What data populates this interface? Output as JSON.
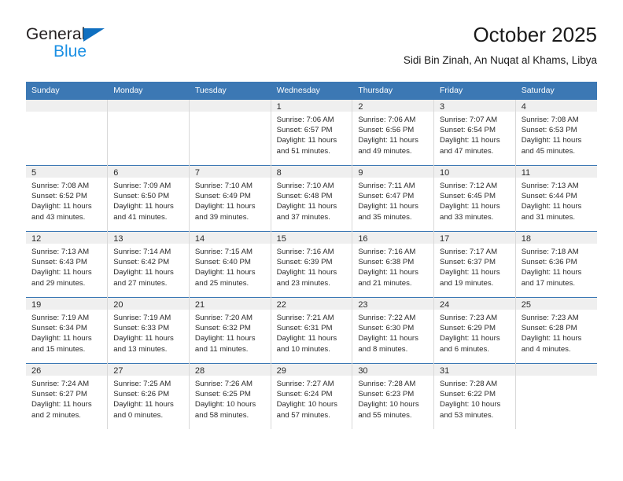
{
  "logo": {
    "word_one": "General",
    "word_two": "Blue",
    "triangle_color": "#0f6fc0",
    "blue_color": "#1a8fe3"
  },
  "header": {
    "title": "October 2025",
    "subtitle": "Sidi Bin Zinah, An Nuqat al Khams, Libya"
  },
  "theme": {
    "header_bg": "#3c78b4",
    "daynum_bg": "#efefef",
    "cell_divider": "#d9d9d9"
  },
  "weekday_headers": [
    "Sunday",
    "Monday",
    "Tuesday",
    "Wednesday",
    "Thursday",
    "Friday",
    "Saturday"
  ],
  "weeks": [
    [
      {
        "day": "",
        "sunrise": "",
        "sunset": "",
        "daylight_line1": "",
        "daylight_line2": ""
      },
      {
        "day": "",
        "sunrise": "",
        "sunset": "",
        "daylight_line1": "",
        "daylight_line2": ""
      },
      {
        "day": "",
        "sunrise": "",
        "sunset": "",
        "daylight_line1": "",
        "daylight_line2": ""
      },
      {
        "day": "1",
        "sunrise": "Sunrise: 7:06 AM",
        "sunset": "Sunset: 6:57 PM",
        "daylight_line1": "Daylight: 11 hours",
        "daylight_line2": "and 51 minutes."
      },
      {
        "day": "2",
        "sunrise": "Sunrise: 7:06 AM",
        "sunset": "Sunset: 6:56 PM",
        "daylight_line1": "Daylight: 11 hours",
        "daylight_line2": "and 49 minutes."
      },
      {
        "day": "3",
        "sunrise": "Sunrise: 7:07 AM",
        "sunset": "Sunset: 6:54 PM",
        "daylight_line1": "Daylight: 11 hours",
        "daylight_line2": "and 47 minutes."
      },
      {
        "day": "4",
        "sunrise": "Sunrise: 7:08 AM",
        "sunset": "Sunset: 6:53 PM",
        "daylight_line1": "Daylight: 11 hours",
        "daylight_line2": "and 45 minutes."
      }
    ],
    [
      {
        "day": "5",
        "sunrise": "Sunrise: 7:08 AM",
        "sunset": "Sunset: 6:52 PM",
        "daylight_line1": "Daylight: 11 hours",
        "daylight_line2": "and 43 minutes."
      },
      {
        "day": "6",
        "sunrise": "Sunrise: 7:09 AM",
        "sunset": "Sunset: 6:50 PM",
        "daylight_line1": "Daylight: 11 hours",
        "daylight_line2": "and 41 minutes."
      },
      {
        "day": "7",
        "sunrise": "Sunrise: 7:10 AM",
        "sunset": "Sunset: 6:49 PM",
        "daylight_line1": "Daylight: 11 hours",
        "daylight_line2": "and 39 minutes."
      },
      {
        "day": "8",
        "sunrise": "Sunrise: 7:10 AM",
        "sunset": "Sunset: 6:48 PM",
        "daylight_line1": "Daylight: 11 hours",
        "daylight_line2": "and 37 minutes."
      },
      {
        "day": "9",
        "sunrise": "Sunrise: 7:11 AM",
        "sunset": "Sunset: 6:47 PM",
        "daylight_line1": "Daylight: 11 hours",
        "daylight_line2": "and 35 minutes."
      },
      {
        "day": "10",
        "sunrise": "Sunrise: 7:12 AM",
        "sunset": "Sunset: 6:45 PM",
        "daylight_line1": "Daylight: 11 hours",
        "daylight_line2": "and 33 minutes."
      },
      {
        "day": "11",
        "sunrise": "Sunrise: 7:13 AM",
        "sunset": "Sunset: 6:44 PM",
        "daylight_line1": "Daylight: 11 hours",
        "daylight_line2": "and 31 minutes."
      }
    ],
    [
      {
        "day": "12",
        "sunrise": "Sunrise: 7:13 AM",
        "sunset": "Sunset: 6:43 PM",
        "daylight_line1": "Daylight: 11 hours",
        "daylight_line2": "and 29 minutes."
      },
      {
        "day": "13",
        "sunrise": "Sunrise: 7:14 AM",
        "sunset": "Sunset: 6:42 PM",
        "daylight_line1": "Daylight: 11 hours",
        "daylight_line2": "and 27 minutes."
      },
      {
        "day": "14",
        "sunrise": "Sunrise: 7:15 AM",
        "sunset": "Sunset: 6:40 PM",
        "daylight_line1": "Daylight: 11 hours",
        "daylight_line2": "and 25 minutes."
      },
      {
        "day": "15",
        "sunrise": "Sunrise: 7:16 AM",
        "sunset": "Sunset: 6:39 PM",
        "daylight_line1": "Daylight: 11 hours",
        "daylight_line2": "and 23 minutes."
      },
      {
        "day": "16",
        "sunrise": "Sunrise: 7:16 AM",
        "sunset": "Sunset: 6:38 PM",
        "daylight_line1": "Daylight: 11 hours",
        "daylight_line2": "and 21 minutes."
      },
      {
        "day": "17",
        "sunrise": "Sunrise: 7:17 AM",
        "sunset": "Sunset: 6:37 PM",
        "daylight_line1": "Daylight: 11 hours",
        "daylight_line2": "and 19 minutes."
      },
      {
        "day": "18",
        "sunrise": "Sunrise: 7:18 AM",
        "sunset": "Sunset: 6:36 PM",
        "daylight_line1": "Daylight: 11 hours",
        "daylight_line2": "and 17 minutes."
      }
    ],
    [
      {
        "day": "19",
        "sunrise": "Sunrise: 7:19 AM",
        "sunset": "Sunset: 6:34 PM",
        "daylight_line1": "Daylight: 11 hours",
        "daylight_line2": "and 15 minutes."
      },
      {
        "day": "20",
        "sunrise": "Sunrise: 7:19 AM",
        "sunset": "Sunset: 6:33 PM",
        "daylight_line1": "Daylight: 11 hours",
        "daylight_line2": "and 13 minutes."
      },
      {
        "day": "21",
        "sunrise": "Sunrise: 7:20 AM",
        "sunset": "Sunset: 6:32 PM",
        "daylight_line1": "Daylight: 11 hours",
        "daylight_line2": "and 11 minutes."
      },
      {
        "day": "22",
        "sunrise": "Sunrise: 7:21 AM",
        "sunset": "Sunset: 6:31 PM",
        "daylight_line1": "Daylight: 11 hours",
        "daylight_line2": "and 10 minutes."
      },
      {
        "day": "23",
        "sunrise": "Sunrise: 7:22 AM",
        "sunset": "Sunset: 6:30 PM",
        "daylight_line1": "Daylight: 11 hours",
        "daylight_line2": "and 8 minutes."
      },
      {
        "day": "24",
        "sunrise": "Sunrise: 7:23 AM",
        "sunset": "Sunset: 6:29 PM",
        "daylight_line1": "Daylight: 11 hours",
        "daylight_line2": "and 6 minutes."
      },
      {
        "day": "25",
        "sunrise": "Sunrise: 7:23 AM",
        "sunset": "Sunset: 6:28 PM",
        "daylight_line1": "Daylight: 11 hours",
        "daylight_line2": "and 4 minutes."
      }
    ],
    [
      {
        "day": "26",
        "sunrise": "Sunrise: 7:24 AM",
        "sunset": "Sunset: 6:27 PM",
        "daylight_line1": "Daylight: 11 hours",
        "daylight_line2": "and 2 minutes."
      },
      {
        "day": "27",
        "sunrise": "Sunrise: 7:25 AM",
        "sunset": "Sunset: 6:26 PM",
        "daylight_line1": "Daylight: 11 hours",
        "daylight_line2": "and 0 minutes."
      },
      {
        "day": "28",
        "sunrise": "Sunrise: 7:26 AM",
        "sunset": "Sunset: 6:25 PM",
        "daylight_line1": "Daylight: 10 hours",
        "daylight_line2": "and 58 minutes."
      },
      {
        "day": "29",
        "sunrise": "Sunrise: 7:27 AM",
        "sunset": "Sunset: 6:24 PM",
        "daylight_line1": "Daylight: 10 hours",
        "daylight_line2": "and 57 minutes."
      },
      {
        "day": "30",
        "sunrise": "Sunrise: 7:28 AM",
        "sunset": "Sunset: 6:23 PM",
        "daylight_line1": "Daylight: 10 hours",
        "daylight_line2": "and 55 minutes."
      },
      {
        "day": "31",
        "sunrise": "Sunrise: 7:28 AM",
        "sunset": "Sunset: 6:22 PM",
        "daylight_line1": "Daylight: 10 hours",
        "daylight_line2": "and 53 minutes."
      },
      {
        "day": "",
        "sunrise": "",
        "sunset": "",
        "daylight_line1": "",
        "daylight_line2": ""
      }
    ]
  ]
}
